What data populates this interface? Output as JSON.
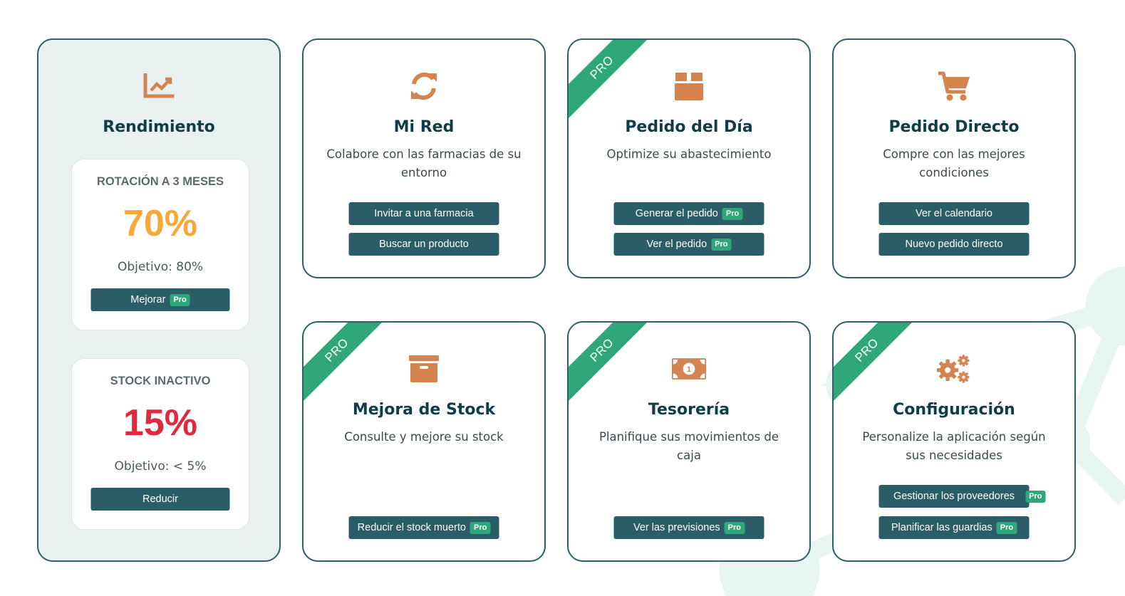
{
  "performance": {
    "title": "Rendimiento",
    "icon": "chart-line-icon",
    "kpis": [
      {
        "title": "ROTACIÓN A 3 MESES",
        "value": "70%",
        "value_color": "#f4a938",
        "target": "Objetivo: 80%",
        "button": "Mejorar",
        "pro": "Pro"
      },
      {
        "title": "STOCK INACTIVO",
        "value": "15%",
        "value_color": "#e0283f",
        "target": "Objetivo: < 5%",
        "button": "Reducir"
      }
    ]
  },
  "ribbon_label": "PRO",
  "pro_label": "Pro",
  "colors": {
    "accent": "#d4854f",
    "button": "#2b5d68",
    "pro": "#2fa77a",
    "border": "#2f5e68"
  },
  "cards": [
    {
      "title": "Mi Red",
      "icon": "sync-icon",
      "description": "Colabore con las farmacias de su entorno",
      "buttons": [
        "Invitar a una farmacia",
        "Buscar un producto"
      ]
    },
    {
      "title": "Pedido del Día",
      "icon": "box-icon",
      "description": "Optimize su abastecimiento",
      "buttons": [
        "Generar el pedido",
        "Ver el pedido"
      ]
    },
    {
      "title": "Pedido Directo",
      "icon": "shopping-cart-icon",
      "description": "Compre con las mejores condiciones",
      "buttons": [
        "Ver el calendario",
        "Nuevo pedido directo"
      ]
    },
    {
      "title": "Mejora de Stock",
      "icon": "archive-icon",
      "description": "Consulte y mejore su stock",
      "buttons": [
        "Reducir el stock muerto"
      ]
    },
    {
      "title": "Tesorería",
      "icon": "money-bill-icon",
      "description": "Planifique sus movimientos de caja",
      "buttons": [
        "Ver las previsiones"
      ]
    },
    {
      "title": "Configuración",
      "icon": "cogs-icon",
      "description": "Personalize la aplicación según sus necesidades",
      "buttons": [
        "Gestionar los proveedores",
        "Planificar las guardias"
      ]
    }
  ]
}
